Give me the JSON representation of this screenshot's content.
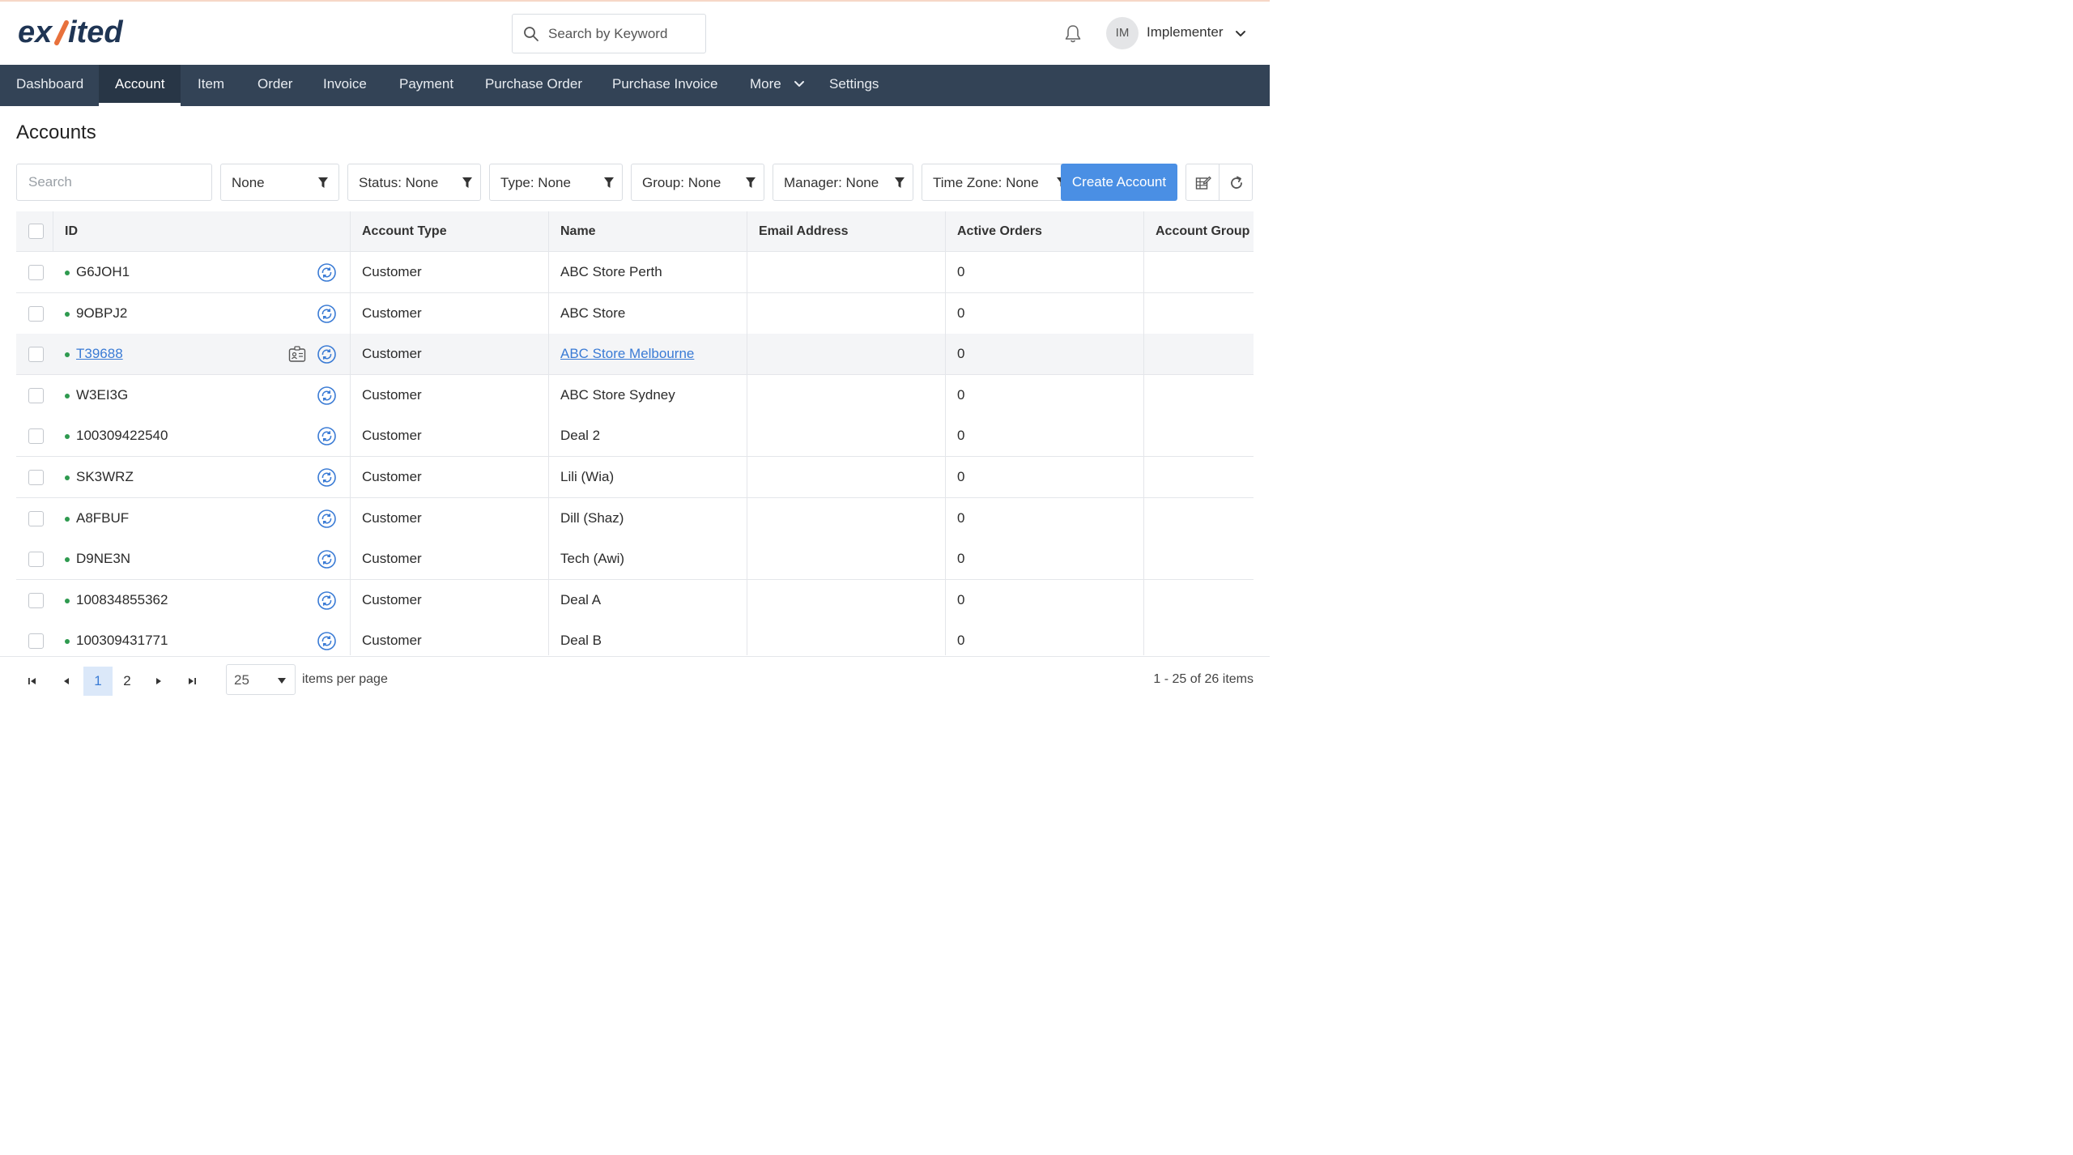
{
  "brand": {
    "logo_text": "exsited"
  },
  "header": {
    "search_placeholder": "Search by Keyword",
    "user_initials": "IM",
    "user_name": "Implementer"
  },
  "nav": {
    "items": [
      {
        "label": "Dashboard"
      },
      {
        "label": "Account",
        "active": true
      },
      {
        "label": "Item"
      },
      {
        "label": "Order"
      },
      {
        "label": "Invoice"
      },
      {
        "label": "Payment"
      },
      {
        "label": "Purchase Order"
      },
      {
        "label": "Purchase Invoice"
      },
      {
        "label": "More",
        "has_dropdown": true
      },
      {
        "label": "Settings"
      }
    ]
  },
  "page": {
    "title": "Accounts"
  },
  "filters": {
    "search_placeholder": "Search",
    "view": "None",
    "status": "Status: None",
    "type": "Type: None",
    "group": "Group: None",
    "manager": "Manager: None",
    "timezone": "Time Zone: None",
    "create_label": "Create Account"
  },
  "table": {
    "columns": [
      "ID",
      "Account Type",
      "Name",
      "Email Address",
      "Active Orders",
      "Account Group"
    ],
    "rows": [
      {
        "id": "G6JOH1",
        "type": "Customer",
        "name": "ABC Store Perth",
        "email": "",
        "active_orders": "0",
        "group": ""
      },
      {
        "id": "9OBPJ2",
        "type": "Customer",
        "name": "ABC Store",
        "email": "",
        "active_orders": "0",
        "group": ""
      },
      {
        "id": "T39688",
        "type": "Customer",
        "name": "ABC Store Melbourne",
        "email": "",
        "active_orders": "0",
        "group": "",
        "hovered": true
      },
      {
        "id": "W3EI3G",
        "type": "Customer",
        "name": "ABC Store Sydney",
        "email": "",
        "active_orders": "0",
        "group": ""
      },
      {
        "id": "100309422540",
        "type": "Customer",
        "name": "Deal 2",
        "email": "",
        "active_orders": "0",
        "group": ""
      },
      {
        "id": "SK3WRZ",
        "type": "Customer",
        "name": "Lili (Wia)",
        "email": "",
        "active_orders": "0",
        "group": ""
      },
      {
        "id": "A8FBUF",
        "type": "Customer",
        "name": "Dill (Shaz)",
        "email": "",
        "active_orders": "0",
        "group": ""
      },
      {
        "id": "D9NE3N",
        "type": "Customer",
        "name": "Tech (Awi)",
        "email": "",
        "active_orders": "0",
        "group": ""
      },
      {
        "id": "100834855362",
        "type": "Customer",
        "name": "Deal A",
        "email": "",
        "active_orders": "0",
        "group": ""
      },
      {
        "id": "100309431771",
        "type": "Customer",
        "name": "Deal B",
        "email": "",
        "active_orders": "0",
        "group": ""
      }
    ]
  },
  "pagination": {
    "pages": [
      "1",
      "2"
    ],
    "current_page": "1",
    "page_size": "25",
    "per_page_label": "items per page",
    "range_label": "1 - 25 of 26 items"
  },
  "colors": {
    "nav_bg": "#334356",
    "primary": "#4a8fe4",
    "link": "#3a7bd5",
    "status_active": "#2e9a4f",
    "logo_dark": "#1f3554",
    "logo_accent": "#e8713c"
  },
  "icons": {
    "search": "search-icon",
    "bell": "bell-icon",
    "filter": "funnel-icon",
    "sync": "sync-icon",
    "account_card": "contact-card-icon",
    "column_edit": "column-edit-icon",
    "refresh": "refresh-icon"
  }
}
